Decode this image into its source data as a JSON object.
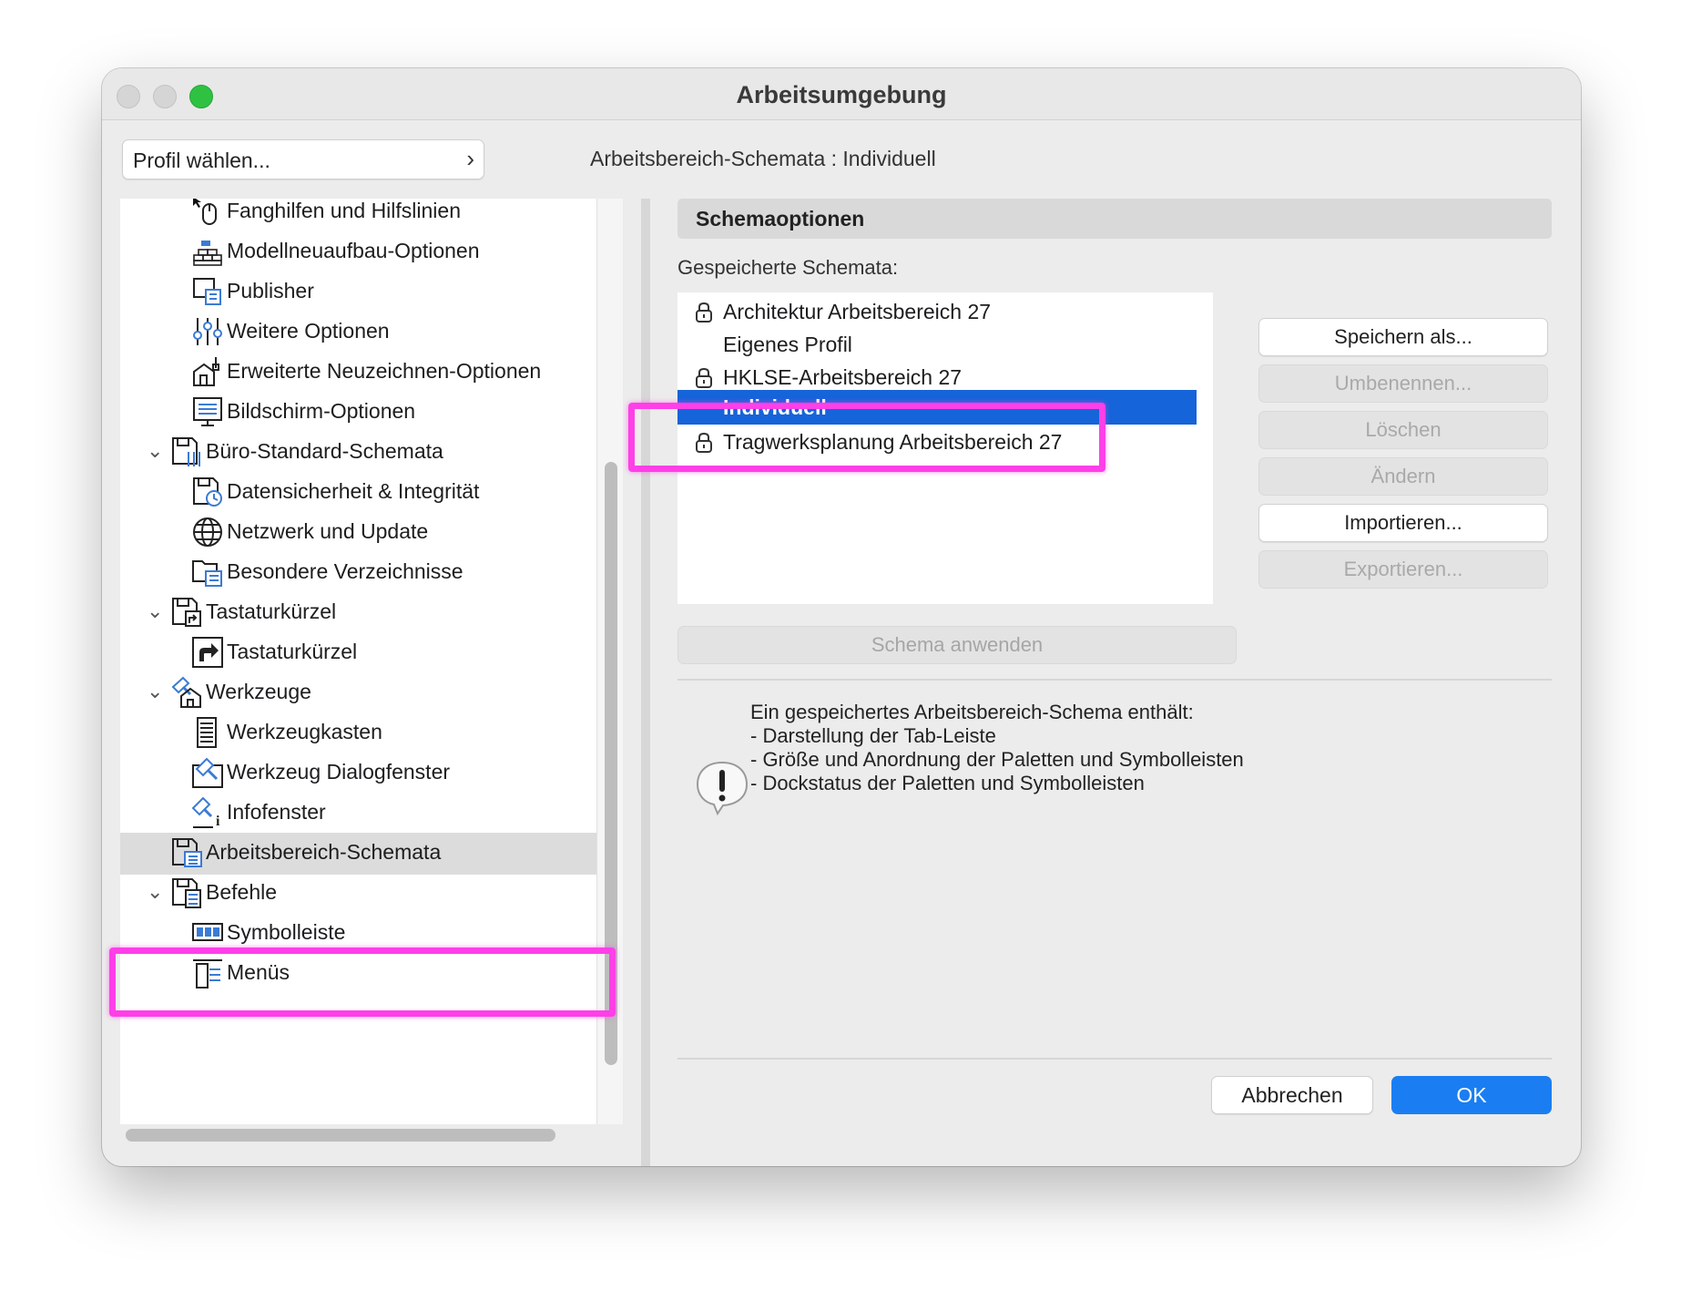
{
  "window": {
    "title": "Arbeitsumgebung"
  },
  "profile": {
    "button_label": "Profil wählen..."
  },
  "header": {
    "scheme_label": "Arbeitsbereich-Schemata :  Individuell"
  },
  "tree": {
    "items": [
      {
        "label": "Fanghilfen und Hilfslinien",
        "icon": "cursor-mouse-icon"
      },
      {
        "label": "Modellneuaufbau-Optionen",
        "icon": "bricks-icon"
      },
      {
        "label": "Publisher",
        "icon": "publisher-icon"
      },
      {
        "label": "Weitere Optionen",
        "icon": "sliders-icon"
      },
      {
        "label": "Erweiterte Neuzeichnen-Optionen",
        "icon": "house-brush-icon"
      },
      {
        "label": "Bildschirm-Optionen",
        "icon": "monitor-icon"
      },
      {
        "label": "Büro-Standard-Schemata",
        "icon": "floppy-sliders-icon",
        "expanded": true
      },
      {
        "label": "Datensicherheit & Integrität",
        "icon": "floppy-clock-icon"
      },
      {
        "label": "Netzwerk und Update",
        "icon": "globe-icon"
      },
      {
        "label": "Besondere Verzeichnisse",
        "icon": "folder-list-icon"
      },
      {
        "label": "Tastaturkürzel",
        "icon": "floppy-shortcut-icon",
        "expanded": true
      },
      {
        "label": "Tastaturkürzel",
        "icon": "shortcut-arrow-icon"
      },
      {
        "label": "Werkzeuge",
        "icon": "hammer-house-icon",
        "expanded": true
      },
      {
        "label": "Werkzeugkasten",
        "icon": "toolbox-icon"
      },
      {
        "label": "Werkzeug Dialogfenster",
        "icon": "hammer-dialog-icon"
      },
      {
        "label": "Infofenster",
        "icon": "hammer-info-icon"
      },
      {
        "label": "Arbeitsbereich-Schemata",
        "icon": "floppy-window-icon",
        "selected": true
      },
      {
        "label": "Befehle",
        "icon": "floppy-list-icon",
        "expanded": true
      },
      {
        "label": "Symbolleiste",
        "icon": "toolbar-icon"
      },
      {
        "label": "Menüs",
        "icon": "menu-list-icon"
      }
    ]
  },
  "options": {
    "section_title": "Schemaoptionen",
    "saved_label": "Gespeicherte Schemata:",
    "schemas": [
      {
        "label": "Architektur Arbeitsbereich 27",
        "locked": true
      },
      {
        "label": "Eigenes Profil",
        "locked": false
      },
      {
        "label": "HKLSE-Arbeitsbereich 27",
        "locked": true
      },
      {
        "label": "Individuell",
        "locked": false,
        "selected": true
      },
      {
        "label": "Tragwerksplanung Arbeitsbereich 27",
        "locked": true
      }
    ],
    "buttons": {
      "save_as": "Speichern als...",
      "rename": "Umbenennen...",
      "delete": "Löschen",
      "modify": "Ändern",
      "import": "Importieren...",
      "export": "Exportieren..."
    },
    "apply_button": "Schema anwenden",
    "info_lines": [
      "Ein gespeichertes Arbeitsbereich-Schema enthält:",
      "- Darstellung der Tab-Leiste",
      "- Größe und Anordnung der Paletten und Symbolleisten",
      "- Dockstatus der Paletten und Symbolleisten"
    ]
  },
  "footer": {
    "cancel": "Abbrechen",
    "ok": "OK"
  },
  "colors": {
    "selection": "#1664d9",
    "ok_button": "#1a7ef2",
    "highlight": "#ff3fe8",
    "zoom_light": "#2fc242"
  }
}
